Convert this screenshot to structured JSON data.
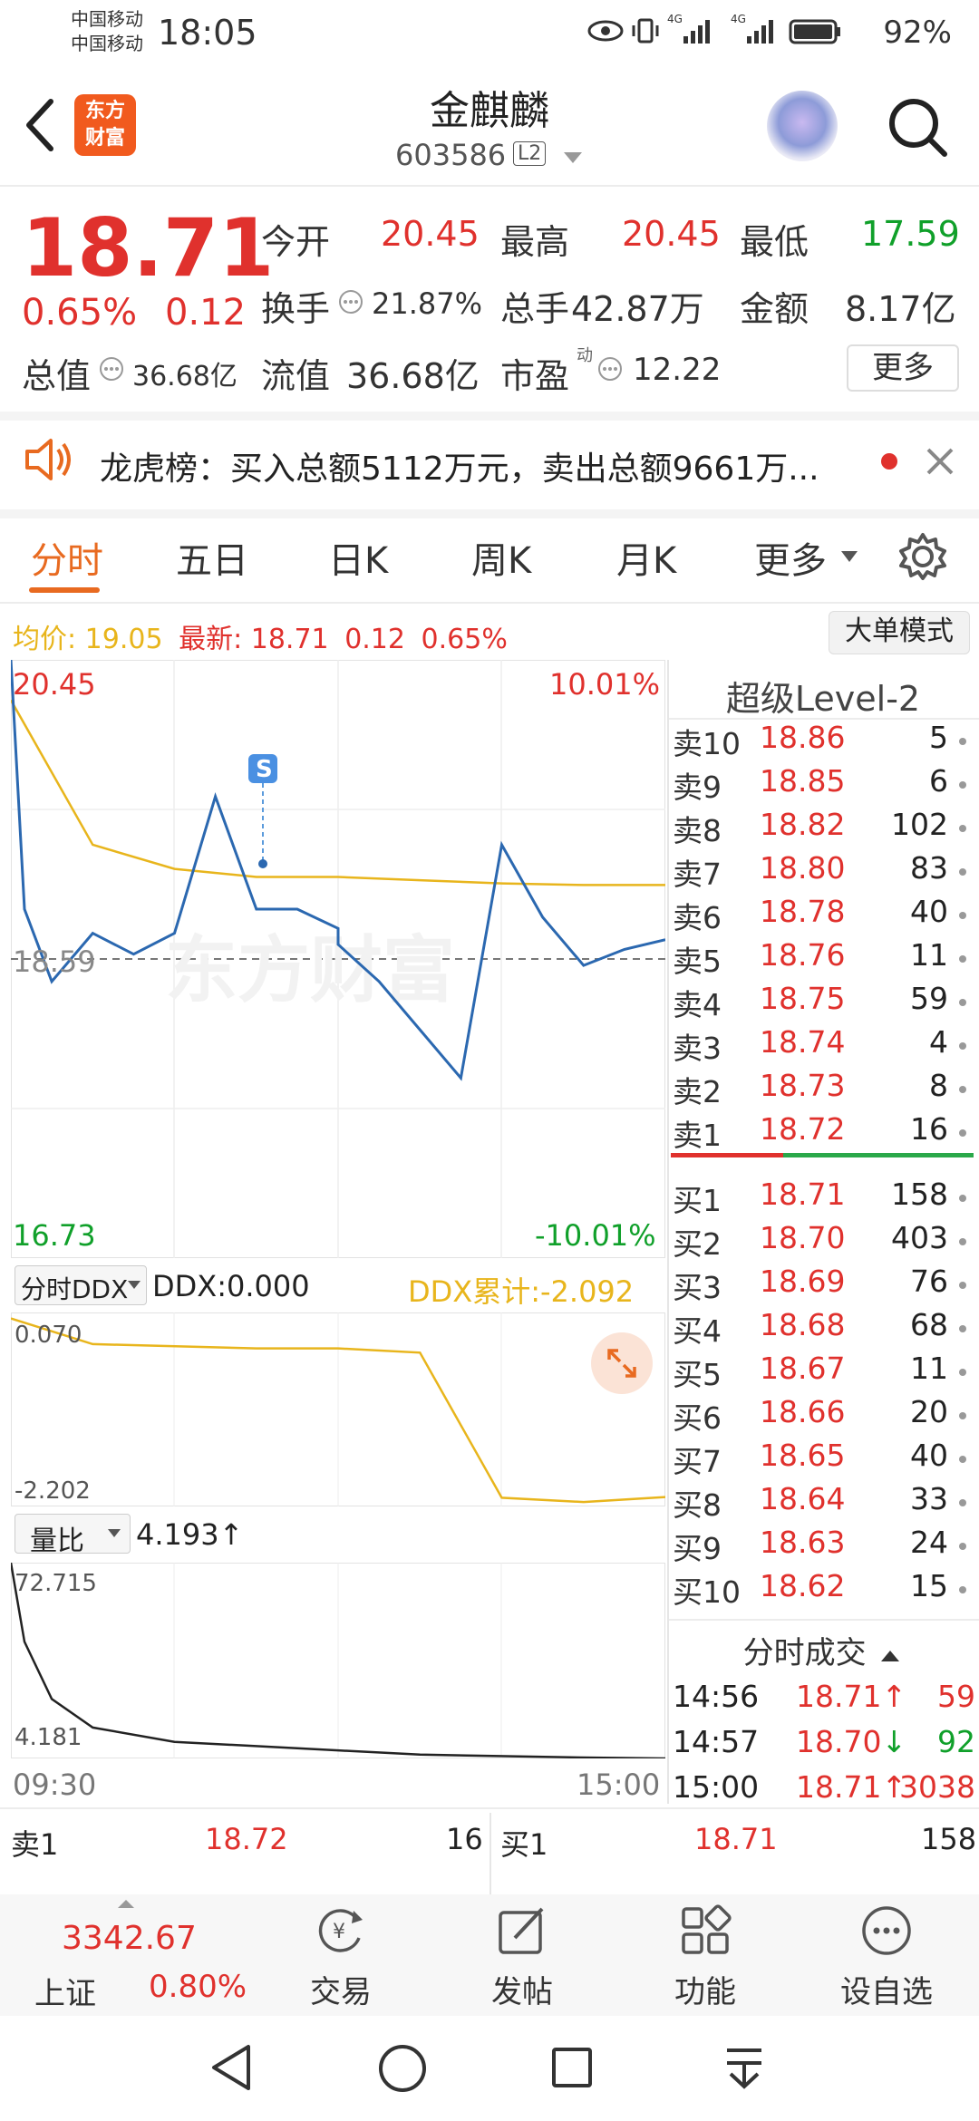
{
  "status_bar": {
    "carrier1": "中国移动",
    "carrier2": "中国移动",
    "time": "18:05",
    "net1": "4G",
    "net2": "4G",
    "battery": "92%"
  },
  "header": {
    "logo_line1": "东方",
    "logo_line2": "财富",
    "name": "金麒麟",
    "code": "603586",
    "level_badge": "L2"
  },
  "quote": {
    "price": "18.71",
    "change_pct": "0.65%",
    "change": "0.12",
    "open_label": "今开",
    "open": "20.45",
    "high_label": "最高",
    "high": "20.45",
    "low_label": "最低",
    "low": "17.59",
    "turnover_label": "换手",
    "turnover": "21.87%",
    "volume_label": "总手",
    "volume": "42.87万",
    "amount_label": "金额",
    "amount": "8.17亿",
    "mktcap_label": "总值",
    "mktcap": "36.68亿",
    "float_label": "流值",
    "float_cap": "36.68亿",
    "pe_label": "市盈",
    "pe_sup": "动",
    "pe": "12.22",
    "more": "更多"
  },
  "notice": {
    "text": "龙虎榜：买入总额5112万元，卖出总额9661万..."
  },
  "tabs": [
    "分时",
    "五日",
    "日K",
    "周K",
    "月K",
    "更多"
  ],
  "chart_header": {
    "avg_label": "均价:",
    "avg": "19.05",
    "latest_label": "最新:",
    "latest": "18.71",
    "change": "0.12",
    "pct": "0.65%",
    "big_order_btn": "大单模式"
  },
  "chart_labels": {
    "y_top": "20.45",
    "y_mid": "18.59",
    "y_bottom": "16.73",
    "pct_top": "10.01%",
    "pct_bottom": "-10.01%",
    "marker": "S",
    "watermark": "东方财富",
    "ddx_select": "分时DDX",
    "ddx": "DDX:0.000",
    "ddx_sum": "DDX累计:-2.092",
    "ddx_top": "0.070",
    "ddx_bottom": "-2.202",
    "vr_select": "量比",
    "vr_value": "4.193↑",
    "vr_top": "72.715",
    "vr_bottom": "4.181",
    "time_start": "09:30",
    "time_end": "15:00"
  },
  "chart_data": {
    "type": "line",
    "series": [
      {
        "x": [
          "09:30",
          "09:35",
          "09:45",
          "10:00",
          "10:15",
          "10:30",
          "10:45",
          "11:00",
          "11:15",
          "11:30",
          "13:00",
          "13:15",
          "13:30",
          "13:45",
          "14:00",
          "14:15",
          "14:30",
          "14:45",
          "15:00"
        ],
        "y": [
          20.45,
          18.9,
          18.45,
          18.75,
          18.62,
          18.75,
          19.6,
          18.9,
          18.9,
          18.78,
          18.68,
          18.45,
          18.15,
          17.85,
          19.3,
          18.85,
          18.55,
          18.65,
          18.71
        ]
      },
      {
        "x": [
          "09:30",
          "10:00",
          "10:30",
          "11:00",
          "11:30",
          "13:30",
          "14:00",
          "14:30",
          "15:00"
        ],
        "y": [
          20.2,
          19.3,
          19.15,
          19.1,
          19.1,
          19.08,
          19.06,
          19.05,
          19.05
        ]
      }
    ],
    "ylim": [
      16.73,
      20.45
    ],
    "ddx_cumulative": {
      "x": [
        "09:30",
        "10:00",
        "11:00",
        "11:30",
        "13:30",
        "14:00",
        "14:30",
        "15:00"
      ],
      "y": [
        0.0,
        -0.3,
        -0.35,
        -0.35,
        -0.4,
        -2.1,
        -2.15,
        -2.092
      ],
      "ylim": [
        -2.202,
        0.07
      ]
    },
    "volume_ratio": {
      "x": [
        "09:30",
        "09:35",
        "09:45",
        "10:00",
        "10:30",
        "11:30",
        "13:30",
        "14:30",
        "15:00"
      ],
      "y": [
        72.7,
        45,
        25,
        15,
        10,
        7,
        5.5,
        4.5,
        4.193
      ],
      "ylim": [
        4.181,
        72.715
      ]
    }
  },
  "order_book": {
    "title": "超级Level-2",
    "asks": [
      {
        "label": "卖10",
        "price": "18.86",
        "vol": "5"
      },
      {
        "label": "卖9",
        "price": "18.85",
        "vol": "6"
      },
      {
        "label": "卖8",
        "price": "18.82",
        "vol": "102"
      },
      {
        "label": "卖7",
        "price": "18.80",
        "vol": "83"
      },
      {
        "label": "卖6",
        "price": "18.78",
        "vol": "40"
      },
      {
        "label": "卖5",
        "price": "18.76",
        "vol": "11"
      },
      {
        "label": "卖4",
        "price": "18.75",
        "vol": "59"
      },
      {
        "label": "卖3",
        "price": "18.74",
        "vol": "4"
      },
      {
        "label": "卖2",
        "price": "18.73",
        "vol": "8"
      },
      {
        "label": "卖1",
        "price": "18.72",
        "vol": "16"
      }
    ],
    "bids": [
      {
        "label": "买1",
        "price": "18.71",
        "vol": "158"
      },
      {
        "label": "买2",
        "price": "18.70",
        "vol": "403"
      },
      {
        "label": "买3",
        "price": "18.69",
        "vol": "76"
      },
      {
        "label": "买4",
        "price": "18.68",
        "vol": "68"
      },
      {
        "label": "买5",
        "price": "18.67",
        "vol": "11"
      },
      {
        "label": "买6",
        "price": "18.66",
        "vol": "20"
      },
      {
        "label": "买7",
        "price": "18.65",
        "vol": "40"
      },
      {
        "label": "买8",
        "price": "18.64",
        "vol": "33"
      },
      {
        "label": "买9",
        "price": "18.63",
        "vol": "24"
      },
      {
        "label": "买10",
        "price": "18.62",
        "vol": "15"
      }
    ]
  },
  "trades": {
    "title": "分时成交",
    "rows": [
      {
        "time": "14:56",
        "price": "18.71",
        "arrow": "↑",
        "vol": "59",
        "side": "buy"
      },
      {
        "time": "14:57",
        "price": "18.70",
        "arrow": "↓",
        "vol": "92",
        "side": "sell"
      },
      {
        "time": "15:00",
        "price": "18.71",
        "arrow": "↑",
        "vol": "3038",
        "side": "buy"
      }
    ]
  },
  "bottom_summary": {
    "ask_label": "卖1",
    "ask_price": "18.72",
    "ask_vol": "16",
    "bid_label": "买1",
    "bid_price": "18.71",
    "bid_vol": "158"
  },
  "bottom_nav": {
    "index_value": "3342.67",
    "index_name": "上证",
    "index_pct": "0.80%",
    "trade": "交易",
    "post": "发帖",
    "func": "功能",
    "watch": "设自选"
  },
  "colors": {
    "up": "#e0312d",
    "down": "#10a02a",
    "price_line": "#2b68b0",
    "avg_line": "#e8b51c",
    "accent": "#e86a20"
  }
}
